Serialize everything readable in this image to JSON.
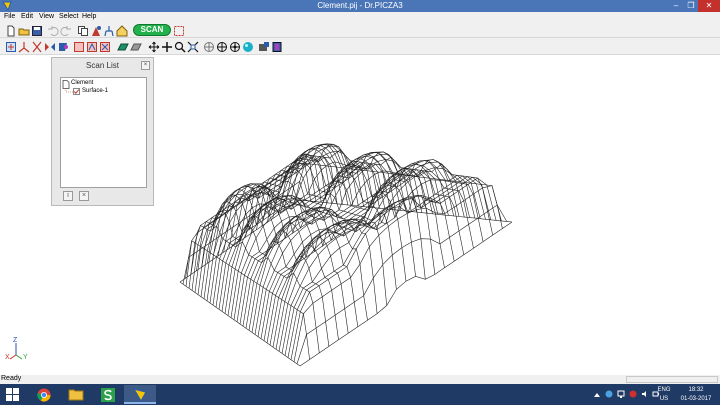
{
  "window": {
    "title": "Clement.pij - Dr.PICZA3"
  },
  "menu": {
    "items": [
      "File",
      "Edit",
      "View",
      "Select",
      "Help"
    ]
  },
  "toolbar": {
    "scan_label": "SCAN"
  },
  "scan_list": {
    "title": "Scan List",
    "close_label": "×",
    "root_label": "Clement",
    "child_label": "Surface-1",
    "child_checked": true,
    "info_btn": "i",
    "delete_btn": "×"
  },
  "axis": {
    "z": "Z",
    "x": "X",
    "y": "Y"
  },
  "status": {
    "text": "Ready"
  },
  "taskbar": {
    "language": "ENG",
    "region": "US",
    "time": "18:32",
    "date": "01-03-2017"
  },
  "colors": {
    "titlebar": "#4a76b8",
    "scan_button": "#22b14c",
    "taskbar": "#1f3a64"
  }
}
